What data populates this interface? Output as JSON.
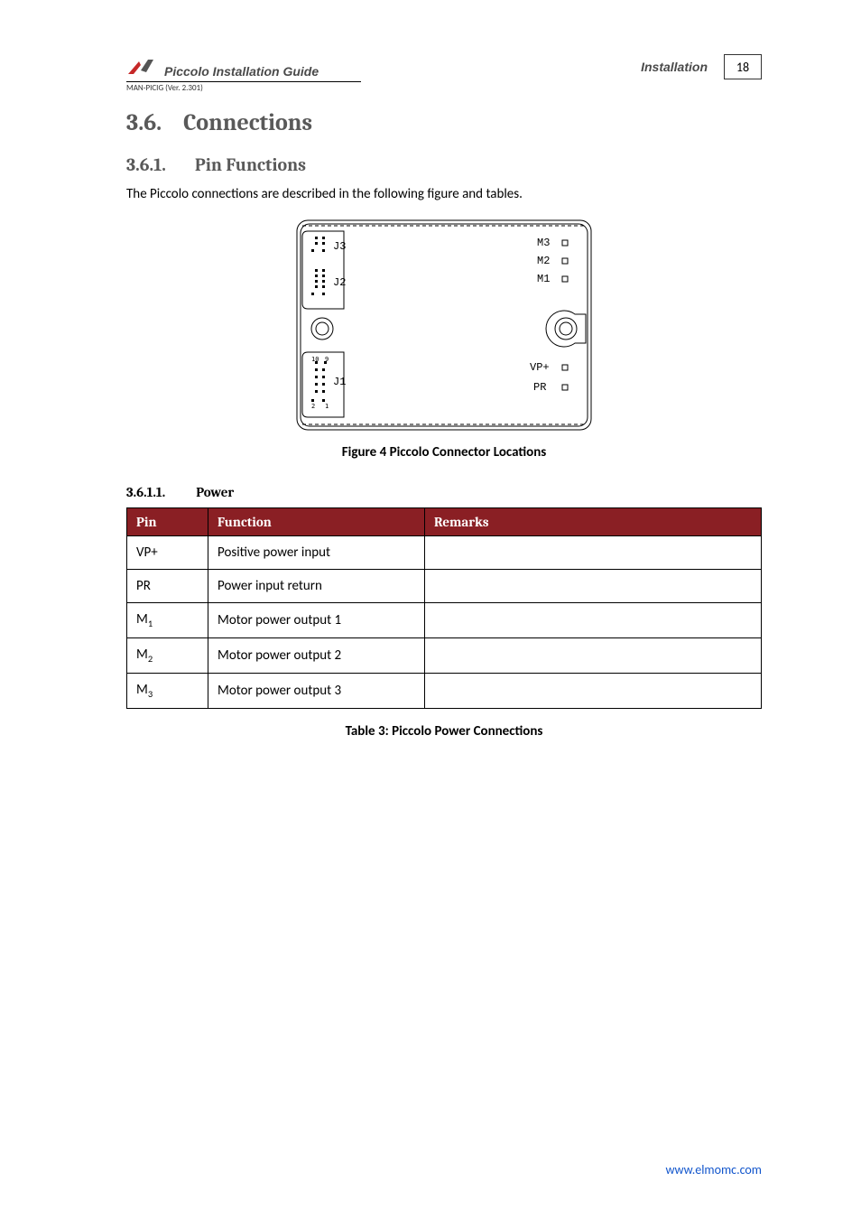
{
  "header": {
    "doc_title": "Piccolo Installation Guide",
    "chapter": "Installation",
    "page_number": "18",
    "version_line": "MAN-PICIG (Ver. 2.301)"
  },
  "section": {
    "num": "3.6.",
    "title": "Connections"
  },
  "subsection": {
    "num": "3.6.1.",
    "title": "Pin Functions",
    "intro": "The Piccolo connections are described in the following figure and tables."
  },
  "figure": {
    "caption": "Figure 4 Piccolo Connector Locations",
    "labels": {
      "j3": "J3",
      "j2": "J2",
      "j1": "J1",
      "m3": "M3",
      "m2": "M2",
      "m1": "M1",
      "vp": "VP+",
      "pr": "PR"
    }
  },
  "subsubsection": {
    "num": "3.6.1.1.",
    "title": "Power"
  },
  "power_table": {
    "headers": {
      "pin": "Pin",
      "function": "Function",
      "remarks": "Remarks"
    },
    "rows": [
      {
        "pin": "VP+",
        "pin_sub": "",
        "function": "Positive power input",
        "remarks": ""
      },
      {
        "pin": "PR",
        "pin_sub": "",
        "function": "Power input return",
        "remarks": ""
      },
      {
        "pin": "M",
        "pin_sub": "1",
        "function": "Motor power output 1",
        "remarks": ""
      },
      {
        "pin": "M",
        "pin_sub": "2",
        "function": "Motor power output 2",
        "remarks": ""
      },
      {
        "pin": "M",
        "pin_sub": "3",
        "function": "Motor power output 3",
        "remarks": ""
      }
    ],
    "caption": "Table 3: Piccolo Power Connections"
  },
  "footer": {
    "url": "www.elmomc.com"
  }
}
